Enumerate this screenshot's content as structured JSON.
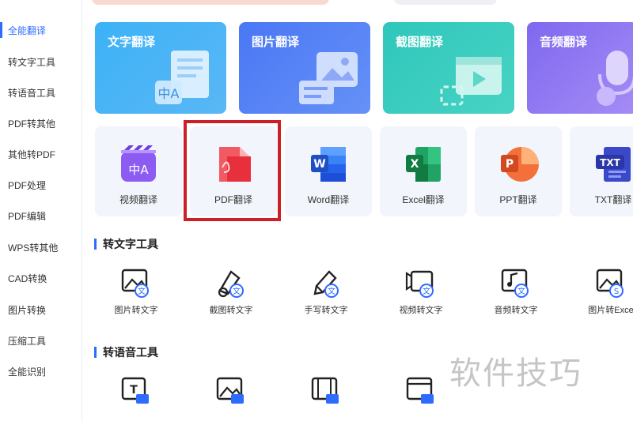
{
  "sidebar": {
    "items": [
      {
        "label": "全能翻译",
        "active": true
      },
      {
        "label": "转文字工具"
      },
      {
        "label": "转语音工具"
      },
      {
        "label": "PDF转其他"
      },
      {
        "label": "其他转PDF"
      },
      {
        "label": "PDF处理"
      },
      {
        "label": "PDF编辑"
      },
      {
        "label": "WPS转其他"
      },
      {
        "label": "CAD转换"
      },
      {
        "label": "图片转换"
      },
      {
        "label": "压缩工具"
      },
      {
        "label": "全能识别"
      }
    ]
  },
  "translate_cards": [
    {
      "label": "文字翻译",
      "color": "#35a7f5"
    },
    {
      "label": "图片翻译",
      "color": "#4f7cf6"
    },
    {
      "label": "截图翻译",
      "color": "#33c8bd"
    },
    {
      "label": "音频翻译",
      "color": "#8f73f2"
    }
  ],
  "doc_cards": [
    {
      "label": "视频翻译",
      "icon": "video-translate-icon"
    },
    {
      "label": "PDF翻译",
      "icon": "pdf-icon"
    },
    {
      "label": "Word翻译",
      "icon": "word-icon"
    },
    {
      "label": "Excel翻译",
      "icon": "excel-icon"
    },
    {
      "label": "PPT翻译",
      "icon": "ppt-icon"
    },
    {
      "label": "TXT翻译",
      "icon": "txt-icon"
    }
  ],
  "sections": {
    "to_text_title": "转文字工具",
    "to_speech_title": "转语音工具"
  },
  "to_text_tools": [
    {
      "label": "图片转文字"
    },
    {
      "label": "截图转文字"
    },
    {
      "label": "手写转文字"
    },
    {
      "label": "视频转文字"
    },
    {
      "label": "音频转文字"
    },
    {
      "label": "图片转Exce"
    }
  ],
  "watermark": "软件技巧"
}
